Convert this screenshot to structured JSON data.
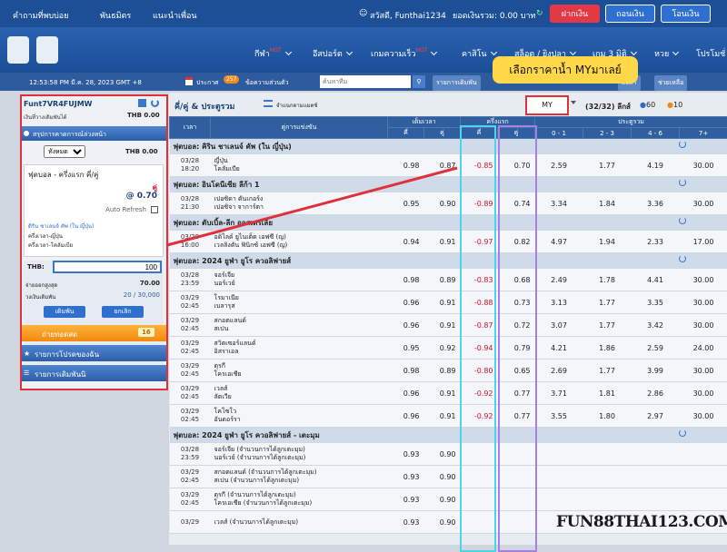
{
  "topbar": {
    "faq": "คำถามที่พบบ่อย",
    "partner": "พันธมิตร",
    "invite": "แนะนำเพื่อน",
    "greeting": "สวัสดี, Funthai1234",
    "balance": "ยอดเงินรวม: 0.00 บาท",
    "deposit": "ฝากเงิน",
    "withdraw": "ถอนเงิน",
    "transfer": "โอนเงิน"
  },
  "nav": {
    "sports": "กีฬา",
    "hot": "HOT",
    "esports": "อีสปอร์ต",
    "fastgames": "เกมความเร็ว",
    "casino": "คาสิโน",
    "slots": "สล็อต / ยิงปลา",
    "games3d": "เกม 3 มิติ",
    "lotto": "หวย",
    "promo": "โปรโมชั่"
  },
  "subbar": {
    "clock": "12:53:58 PM มี.ค. 28, 2023 GMT +8",
    "notice_label": "ประกาศ",
    "notice_count": "257",
    "notice_text": "ข้อความส่วนตัว",
    "search_placeholder": "ค้นหาทีม",
    "bet_list": "รายการเดิมพัน",
    "results": "ผลการแข่งขัน",
    "settings": "ตั้งค่า",
    "help": "ช่วยเหลือ"
  },
  "sidebar": {
    "username": "Funt7VR4FUJMW",
    "balance_label": "เงินที่วางเดิมพันได้",
    "balance_value": "THB  0.00",
    "summary": "สรุปการคาดการณ์ล่วงหน้า",
    "all_option": "ทั้งหมด",
    "thb_total": "THB 0.00",
    "bet_type": "ฟุตบอล - ครึ่งแรก คี่/คู่",
    "selection": "คู่",
    "odds_at": "@",
    "odds_value": "0.70",
    "auto_refresh": "Auto Refresh",
    "league": "ดิริน ชาเลนจ์ คัพ (ใน ญี่ปุ่น)",
    "team_a": "ครึ่งเวลา-ญี่ปุ่น",
    "team_b": "ครึ่งเวลา-โคลัมเบีย",
    "thb_label": "THB:",
    "stake": "100",
    "max_payout_label": "จ่ายออกสูงสุด",
    "max_payout": "70.00",
    "limit_label": "วงเงินเดิมพัน",
    "limit_value": "20 / 30,000",
    "bet_button": "เดิมพัน",
    "cancel_button": "ยกเลิก",
    "live_label": "ถ่ายทอดสด",
    "live_count": "16",
    "fav_label": "รายการโปรดของฉัน",
    "bets_label": "รายการเดิมพันนิ"
  },
  "main": {
    "title": "คี่/คู่ & ประตูรวม",
    "sort_label": "จำแนกตามแมตช์",
    "callout": "เลือกราคาน้ำ MYมาเลย์",
    "odds_format": "MY",
    "league_count": "(32/32) ลีกส์",
    "count_a": "60",
    "count_b": "10"
  },
  "table_header": {
    "time": "เวลา",
    "match": "คู่การแข่งขัน",
    "full_time": "เต็มเวลา",
    "first_half": "ครึ่งแรก",
    "total_goals": "ประตูรวม",
    "odd": "คี่",
    "even": "คู่",
    "g1": "0 - 1",
    "g2": "2 - 3",
    "g3": "4 - 6",
    "g4": "7+"
  },
  "leagues": [
    {
      "name": "ฟุตบอล: คิริน ชาเลนจ์ คัพ (ใน ญี่ปุ่น)",
      "matches": [
        {
          "date": "03/28",
          "time": "18:20",
          "home": "ญี่ปุ่น",
          "away": "โคลัมเบีย",
          "ft_odd": "0.98",
          "ft_even": "0.87",
          "h1_odd": "-0.85",
          "h1_even": "0.70",
          "g1": "2.59",
          "g2": "1.77",
          "g3": "4.19",
          "g4": "30.00"
        }
      ]
    },
    {
      "name": "ฟุตบอล: อินโดนีเซีย ลีก้า 1",
      "matches": [
        {
          "date": "03/28",
          "time": "21:30",
          "home": "เปอซิดา ดันเกอร์ง",
          "away": "เปอซิจา จาการ์ตา",
          "ft_odd": "0.95",
          "ft_even": "0.90",
          "h1_odd": "-0.89",
          "h1_even": "0.74",
          "g1": "3.34",
          "g2": "1.84",
          "g3": "3.36",
          "g4": "30.00"
        }
      ]
    },
    {
      "name": "ฟุตบอล: ดับเบิ้ล-ลีก ออสเตรเลีย",
      "matches": [
        {
          "date": "03/28",
          "time": "16:00",
          "home": "อดิไลด์ ยูไนเต็ด เอฟซี (ญ)",
          "away": "เวลลิงตัน ฟินิกซ์ เอฟซี (ญ)",
          "ft_odd": "0.94",
          "ft_even": "0.91",
          "h1_odd": "-0.97",
          "h1_even": "0.82",
          "g1": "4.97",
          "g2": "1.94",
          "g3": "2.33",
          "g4": "17.00"
        }
      ]
    },
    {
      "name": "ฟุตบอล: 2024 ยูฟ่า ยูโร ควอลิฟายส์",
      "matches": [
        {
          "date": "03/28",
          "time": "23:59",
          "home": "จอร์เจีย",
          "away": "นอร์เวย์",
          "ft_odd": "0.98",
          "ft_even": "0.89",
          "h1_odd": "-0.83",
          "h1_even": "0.68",
          "g1": "2.49",
          "g2": "1.78",
          "g3": "4.41",
          "g4": "30.00"
        },
        {
          "date": "03/29",
          "time": "02:45",
          "home": "โรมาเนีย",
          "away": "เบลารุส",
          "ft_odd": "0.96",
          "ft_even": "0.91",
          "h1_odd": "-0.88",
          "h1_even": "0.73",
          "g1": "3.13",
          "g2": "1.77",
          "g3": "3.35",
          "g4": "30.00"
        },
        {
          "date": "03/29",
          "time": "02:45",
          "home": "สกอตแลนด์",
          "away": "สเปน",
          "ft_odd": "0.96",
          "ft_even": "0.91",
          "h1_odd": "-0.87",
          "h1_even": "0.72",
          "g1": "3.07",
          "g2": "1.77",
          "g3": "3.42",
          "g4": "30.00"
        },
        {
          "date": "03/29",
          "time": "02:45",
          "home": "สวิตเซอร์แลนด์",
          "away": "อิสราเอล",
          "ft_odd": "0.95",
          "ft_even": "0.92",
          "h1_odd": "-0.94",
          "h1_even": "0.79",
          "g1": "4.21",
          "g2": "1.86",
          "g3": "2.59",
          "g4": "24.00"
        },
        {
          "date": "03/29",
          "time": "02:45",
          "home": "ตุรกี",
          "away": "โครเอเชีย",
          "ft_odd": "0.98",
          "ft_even": "0.89",
          "h1_odd": "-0.80",
          "h1_even": "0.65",
          "g1": "2.69",
          "g2": "1.77",
          "g3": "3.99",
          "g4": "30.00"
        },
        {
          "date": "03/29",
          "time": "02:45",
          "home": "เวลส์",
          "away": "ลัตเวีย",
          "ft_odd": "0.96",
          "ft_even": "0.91",
          "h1_odd": "-0.92",
          "h1_even": "0.77",
          "g1": "3.71",
          "g2": "1.81",
          "g3": "2.86",
          "g4": "30.00"
        },
        {
          "date": "03/29",
          "time": "02:45",
          "home": "โคโซโว",
          "away": "อันดอร์รา",
          "ft_odd": "0.96",
          "ft_even": "0.91",
          "h1_odd": "-0.92",
          "h1_even": "0.77",
          "g1": "3.55",
          "g2": "1.80",
          "g3": "2.97",
          "g4": "30.00"
        }
      ]
    },
    {
      "name": "ฟุตบอล: 2024 ยูฟ่า ยูโร ควอลิฟายส์ - เตะมุม",
      "matches": [
        {
          "date": "03/28",
          "time": "23:59",
          "home": "จอร์เจีย (จำนวนการได้ลูกเตะมุม)",
          "away": "นอร์เวย์ (จำนวนการได้ลูกเตะมุม)",
          "ft_odd": "0.93",
          "ft_even": "0.90",
          "h1_odd": "",
          "h1_even": "",
          "g1": "",
          "g2": "",
          "g3": "",
          "g4": ""
        },
        {
          "date": "03/29",
          "time": "02:45",
          "home": "สกอตแลนด์ (จำนวนการได้ลูกเตะมุม)",
          "away": "สเปน (จำนวนการได้ลูกเตะมุม)",
          "ft_odd": "0.93",
          "ft_even": "0.90",
          "h1_odd": "",
          "h1_even": "",
          "g1": "",
          "g2": "",
          "g3": "",
          "g4": ""
        },
        {
          "date": "03/29",
          "time": "02:45",
          "home": "ตุรกี (จำนวนการได้ลูกเตะมุม)",
          "away": "โครเอเชีย (จำนวนการได้ลูกเตะมุม)",
          "ft_odd": "0.93",
          "ft_even": "0.90",
          "h1_odd": "",
          "h1_even": "",
          "g1": "",
          "g2": "",
          "g3": "",
          "g4": ""
        },
        {
          "date": "03/29",
          "time": "",
          "home": "เวลส์ (จำนวนการได้ลูกเตะมุม)",
          "away": "",
          "ft_odd": "0.93",
          "ft_even": "0.90",
          "h1_odd": "",
          "h1_even": "",
          "g1": "",
          "g2": "",
          "g3": "",
          "g4": ""
        }
      ]
    }
  ],
  "watermark": "FUN88THAI123.COM",
  "colors": {
    "header": "#1c4f95",
    "red": "#e0303c",
    "cyan": "#4fd3e6",
    "purple": "#a57ee6",
    "callout": "#ffd84a"
  }
}
